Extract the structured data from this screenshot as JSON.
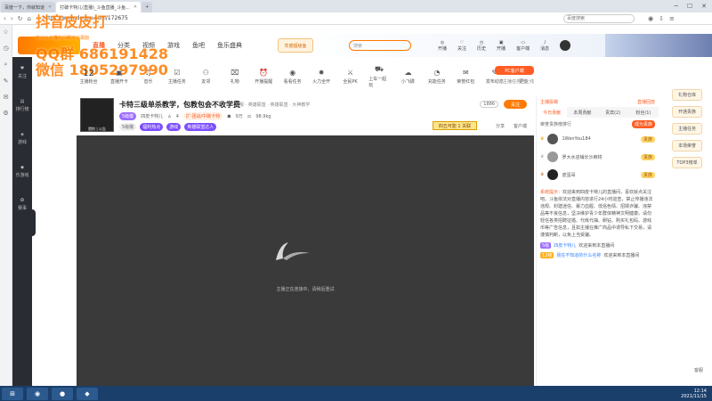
{
  "browser": {
    "tabs": [
      {
        "label": "百度一下，你就知道"
      },
      {
        "label": "打破卡特儿(直播)_斗鱼直播_斗鱼..."
      },
      {
        "label": "+"
      }
    ],
    "url": "https://www.douyu.com/172675",
    "search_placeholder": "百度搜索"
  },
  "watermark": {
    "line1": "抖音皮皮打",
    "line1b": "QQ群 686191428",
    "line2": "微信 1805297990",
    "sub": "有什么不懂的问题可以添加"
  },
  "header": {
    "nav": [
      {
        "label": "直播",
        "active": true
      },
      {
        "label": "分类"
      },
      {
        "label": "视频"
      },
      {
        "label": "游戏"
      },
      {
        "label": "鱼吧"
      },
      {
        "label": "鱼乐盛典"
      }
    ],
    "search_placeholder": "搜索",
    "promo": "年度超级鱼",
    "icons": [
      {
        "label": "开播"
      },
      {
        "label": "关注"
      },
      {
        "label": "历史"
      },
      {
        "label": "开播"
      },
      {
        "label": "客户端"
      },
      {
        "label": "消息"
      }
    ]
  },
  "left_strip": [
    {
      "label": "关注"
    },
    {
      "label": "排行榜"
    },
    {
      "label": "游戏"
    },
    {
      "label": "乐游戏"
    },
    {
      "label": "赛事"
    }
  ],
  "features": {
    "followers_count": "12",
    "followers_label": "主播粉丝",
    "items": [
      {
        "label": "直播开卡"
      },
      {
        "label": "音乐"
      },
      {
        "label": "主播任务"
      },
      {
        "label": "友邻"
      },
      {
        "label": "礼物"
      },
      {
        "label": "开播提醒"
      },
      {
        "label": "看看任务"
      },
      {
        "label": "火力全开"
      },
      {
        "label": "全民PK"
      },
      {
        "label": "上车一起玩"
      },
      {
        "label": "小飞碟"
      },
      {
        "label": "充能任务"
      },
      {
        "label": "荣誉红包"
      },
      {
        "label": "发布动态"
      },
      {
        "label": "更多"
      }
    ],
    "pc_button": "PC客户端",
    "pc_sub": "主播任务已上线"
  },
  "room": {
    "avatar_label": "猎豹 | 公告",
    "title": "卡特三级单杀教学，包教包会不收学费",
    "categories": "举报 · 英雄联盟 · 英雄联盟 · 大神教学",
    "host": "四皮卡特儿",
    "level": "4",
    "notice": "扩·团战/中路卡特",
    "viewers": "9万",
    "fans": "98.9kg",
    "tags": [
      {
        "label": "5级徽"
      },
      {
        "label": "福利热点"
      },
      {
        "label": "游戏"
      },
      {
        "label": "英雄联盟达人"
      }
    ],
    "rank_badge": "四五可能 1 关联",
    "follow": "关注",
    "follow_mini": "1886",
    "actions": [
      {
        "label": "分享"
      },
      {
        "label": "客户端"
      }
    ]
  },
  "video": {
    "message": "主播正在连接中，请稍后重试"
  },
  "chat": {
    "top_left": "主播投稿",
    "top_right": "直播回放",
    "tabs": [
      {
        "label": "今日贡献",
        "active": true
      },
      {
        "label": "本周贡献"
      },
      {
        "label": "贵宾(2)"
      },
      {
        "label": "粉丝(1)"
      }
    ],
    "rank_title": "荣誉贵族榜排行",
    "rank_button": "成为贵族",
    "rank": [
      {
        "name": "1WenYou184",
        "level": "贵族"
      },
      {
        "name": "罗大水店铺长沙麻将",
        "level": "贵族"
      },
      {
        "name": "皮蛋哥",
        "level": "贵族"
      }
    ],
    "system_label": "系统提示：",
    "system_text": "欢迎来到四皮卡特儿的直播间，喜欢就点关注吧。斗鱼依法对直播内容进行24小时巡查，禁止传播违法违规、封建迷信、暴力血腥、低俗色情、招嫖诈骗、违禁品等不良信息，坚决维护青少年群体精神文明健康。请勿轻信各类招聘征婚、代练代抽、刷钻、购买礼包码、游戏币等广告信息，且如主播在推广商品中诱导私下交易，请谨慎判断，以免上当受骗。",
    "lines": [
      {
        "tag": "5级",
        "user": "四皮卡特儿",
        "text": "欢迎来到本直播间"
      },
      {
        "tag": "12级",
        "user": "我在不知道的什么名称",
        "text": "欢迎来到本直播间"
      }
    ]
  },
  "right_ads": [
    {
      "label": "礼物仓库"
    },
    {
      "label": "开通贵族"
    },
    {
      "label": "主播任务"
    },
    {
      "label": "本场荣誉"
    },
    {
      "label": "TOP3榜单"
    }
  ],
  "float_help": "客服",
  "taskbar": {
    "time": "12:14",
    "date": "2021/11/15"
  }
}
